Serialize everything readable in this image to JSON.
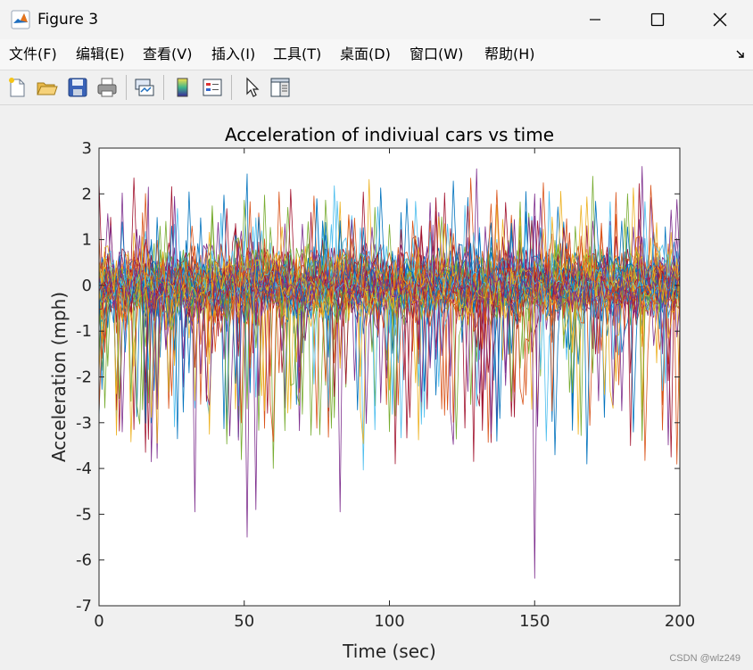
{
  "window": {
    "title": "Figure 3",
    "controls": [
      "minimize",
      "maximize",
      "close"
    ]
  },
  "menu": [
    {
      "label": "文件(F)"
    },
    {
      "label": "编辑(E)"
    },
    {
      "label": "查看(V)"
    },
    {
      "label": "插入(I)"
    },
    {
      "label": "工具(T)"
    },
    {
      "label": "桌面(D)"
    },
    {
      "label": "窗口(W)"
    },
    {
      "label": "帮助(H)"
    }
  ],
  "toolbar": {
    "buttons": [
      "new-figure-icon",
      "open-file-icon",
      "save-icon",
      "print-icon",
      "link-plot-icon",
      "colorbar-icon",
      "legend-icon",
      "edit-plot-arrow-icon",
      "property-inspector-icon"
    ]
  },
  "watermark": "CSDN @wlz249",
  "colors": {
    "series_palette": [
      "#0072BD",
      "#D95319",
      "#EDB120",
      "#7E2F8E",
      "#77AC30",
      "#4DBEEE",
      "#A2142F"
    ],
    "axes_background": "#ffffff",
    "figure_background": "#f0f0f0"
  },
  "chart_data": {
    "type": "line",
    "title": "Acceleration of indiviual cars vs time",
    "xlabel": "Time (sec)",
    "ylabel": "Acceleration (mph)",
    "xlim": [
      0,
      200
    ],
    "ylim": [
      -7,
      3
    ],
    "xticks": [
      0,
      50,
      100,
      150,
      200
    ],
    "yticks": [
      -7,
      -6,
      -5,
      -4,
      -3,
      -2,
      -1,
      0,
      1,
      2,
      3
    ],
    "grid": false,
    "legend": "none",
    "sampling_interval_sec": 1,
    "series_count": 60,
    "series_description": "60 noisy car acceleration traces sampled every 1 s over 0-200 s, values mostly within about -1..1 mph, with occasional spikes",
    "notable_extremes": [
      {
        "x": 130,
        "y": 2.55
      },
      {
        "x": 150,
        "y": 2.0
      },
      {
        "x": 187,
        "y": 2.6
      },
      {
        "x": 17,
        "y": 2.15
      },
      {
        "x": 33,
        "y": -4.95
      },
      {
        "x": 51,
        "y": -5.5
      },
      {
        "x": 54,
        "y": -4.9
      },
      {
        "x": 83,
        "y": -4.95
      },
      {
        "x": 150,
        "y": -6.4
      },
      {
        "x": 129,
        "y": -3.85
      },
      {
        "x": 102,
        "y": -3.9
      },
      {
        "x": 16,
        "y": -3.65
      },
      {
        "x": 183,
        "y": -3.5
      },
      {
        "x": 197,
        "y": -3.75
      }
    ]
  }
}
